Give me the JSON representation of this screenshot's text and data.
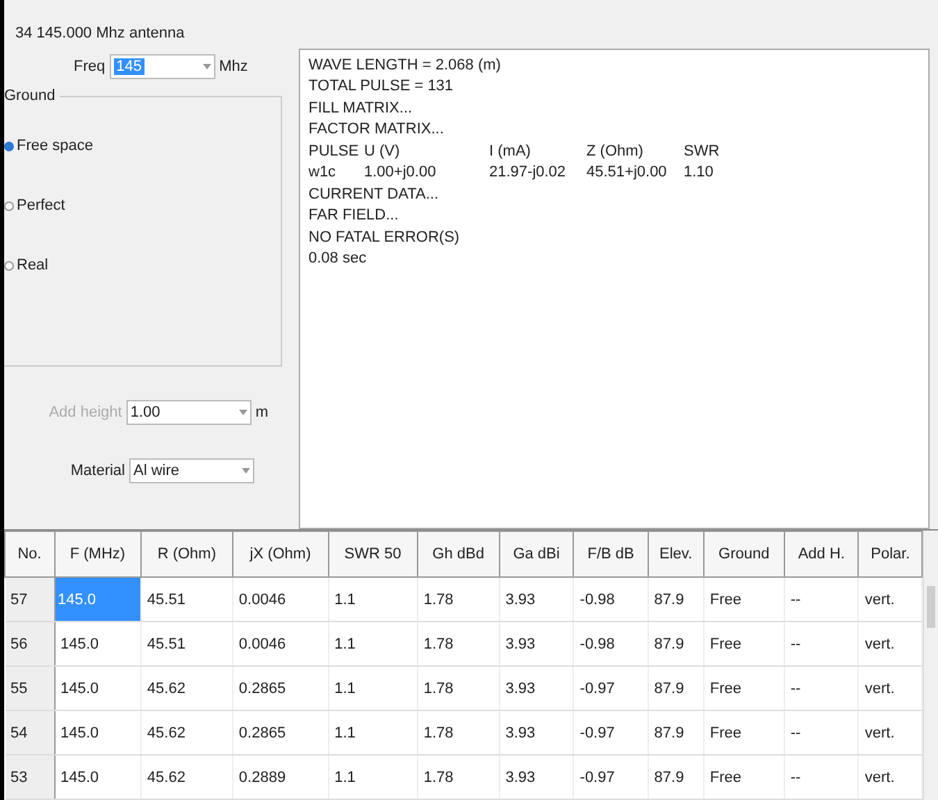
{
  "window": {
    "title": "34 145.000 Mhz antenna"
  },
  "freq": {
    "label": "Freq",
    "value": "145",
    "unit": "Mhz"
  },
  "ground": {
    "title": "Ground",
    "options": [
      {
        "label": "Free space",
        "selected": true
      },
      {
        "label": "Perfect",
        "selected": false
      },
      {
        "label": "Real",
        "selected": false
      }
    ]
  },
  "add_height": {
    "label": "Add height",
    "value": "1.00",
    "unit": "m",
    "disabled": true
  },
  "material": {
    "label": "Material",
    "value": "Al wire"
  },
  "output": [
    [
      "WAVE LENGTH = 2.068 (m)"
    ],
    [
      "TOTAL PULSE = 131"
    ],
    [
      "FILL MATRIX..."
    ],
    [
      "FACTOR MATRIX..."
    ],
    [
      "PULSE",
      "U (V)",
      "I (mA)",
      "Z (Ohm)",
      "SWR"
    ],
    [
      "w1c",
      "1.00+j0.00",
      "21.97-j0.02",
      "45.51+j0.00",
      "1.10"
    ],
    [
      "CURRENT DATA..."
    ],
    [
      "FAR FIELD..."
    ],
    [
      "NO FATAL ERROR(S)"
    ],
    [
      "0.08 sec"
    ]
  ],
  "table": {
    "columns": [
      "No.",
      "F (MHz)",
      "R (Ohm)",
      "jX (Ohm)",
      "SWR 50",
      "Gh dBd",
      "Ga dBi",
      "F/B dB",
      "Elev.",
      "Ground",
      "Add H.",
      "Polar."
    ],
    "rows": [
      {
        "selected": true,
        "cells": [
          "57",
          "145.0",
          "45.51",
          "0.0046",
          "1.1",
          "1.78",
          "3.93",
          "-0.98",
          "87.9",
          "Free",
          "--",
          "vert."
        ]
      },
      {
        "selected": false,
        "cells": [
          "56",
          "145.0",
          "45.51",
          "0.0046",
          "1.1",
          "1.78",
          "3.93",
          "-0.98",
          "87.9",
          "Free",
          "--",
          "vert."
        ]
      },
      {
        "selected": false,
        "cells": [
          "55",
          "145.0",
          "45.62",
          "0.2865",
          "1.1",
          "1.78",
          "3.93",
          "-0.97",
          "87.9",
          "Free",
          "--",
          "vert."
        ]
      },
      {
        "selected": false,
        "cells": [
          "54",
          "145.0",
          "45.62",
          "0.2865",
          "1.1",
          "1.78",
          "3.93",
          "-0.97",
          "87.9",
          "Free",
          "--",
          "vert."
        ]
      },
      {
        "selected": false,
        "cells": [
          "53",
          "145.0",
          "45.62",
          "0.2889",
          "1.1",
          "1.78",
          "3.93",
          "-0.97",
          "87.9",
          "Free",
          "--",
          "vert."
        ]
      }
    ]
  }
}
